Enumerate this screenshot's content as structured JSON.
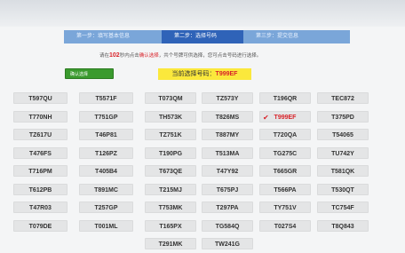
{
  "steps": [
    {
      "label": "第一步：填写基本信息"
    },
    {
      "label": "第二步：选择号码"
    },
    {
      "label": "第三步：提交信息"
    }
  ],
  "notice": {
    "prefix": "请在",
    "count": "102",
    "middle": "秒内点击",
    "highlight": "确认选择",
    "suffix": "，共个号牌可供选择，您可点击号码进行选择。"
  },
  "confirm_button": {
    "label": "确认选择"
  },
  "current_selection": {
    "label": "当前选择号码：",
    "value": "T999EF"
  },
  "plates": [
    [
      "T597QU",
      "T5571F",
      "T073QM",
      "TZ573Y",
      "T196QR",
      "TEC872"
    ],
    [
      "T770NH",
      "T751GP",
      "TH573K",
      "T826MS",
      "T999EF",
      "T375PD"
    ],
    [
      "TZ617U",
      "T46P81",
      "TZ751K",
      "T887MY",
      "T720QA",
      "T54065"
    ],
    [
      "T476FS",
      "T126PZ",
      "T190PG",
      "T513MA",
      "TG275C",
      "TU742Y"
    ],
    [
      "T716PM",
      "T405B4",
      "T673QE",
      "T47Y92",
      "T665GR",
      "T581QK"
    ],
    [
      "T612PB",
      "T891MC",
      "T215MJ",
      "T675PJ",
      "T566PA",
      "T530QT"
    ],
    [
      "T47R03",
      "T257GP",
      "T753MK",
      "T297PA",
      "TY751V",
      "TC754F"
    ],
    [
      "T079DE",
      "T001ML",
      "T165PX",
      "TG584Q",
      "T027S4",
      "T8Q843"
    ],
    [
      "",
      "",
      "T291MK",
      "TW241G",
      "",
      ""
    ]
  ],
  "selected_plate": "T999EF"
}
